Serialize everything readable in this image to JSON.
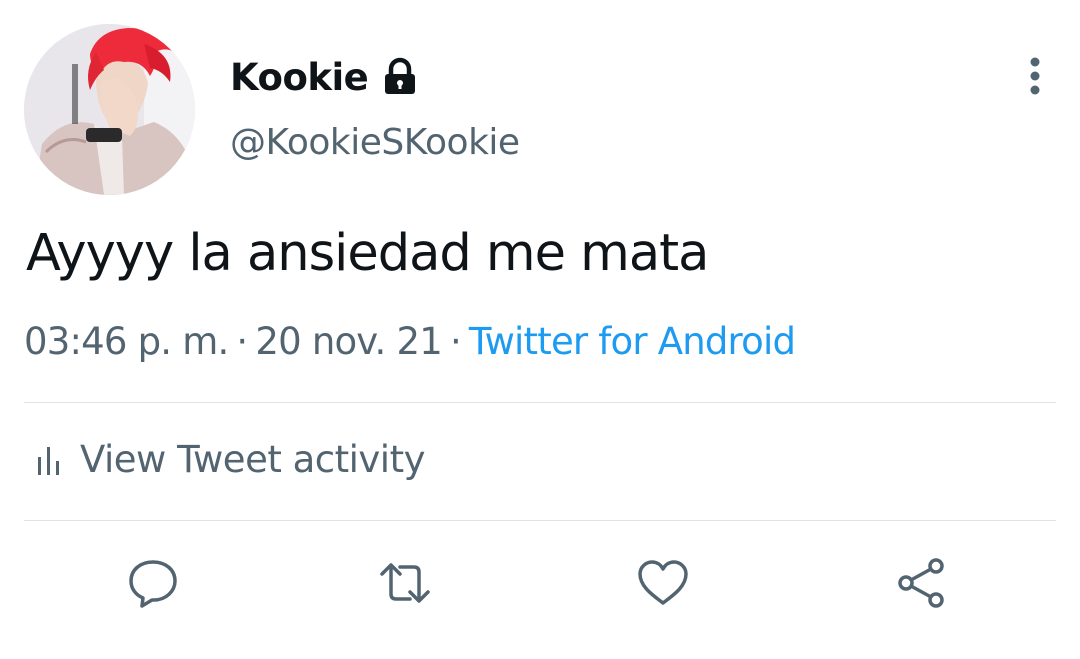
{
  "tweet": {
    "author": {
      "display_name": "Kookie",
      "handle": "@KookieSKookie",
      "protected": true,
      "avatar_icon": "profile-photo"
    },
    "text": "Ayyyy la ansiedad me mata",
    "time": "03:46 p. m.",
    "separator": "·",
    "date": "20 nov. 21",
    "source": "Twitter for Android",
    "activity_label": "View Tweet activity"
  },
  "icons": {
    "lock": "lock-icon",
    "more": "more-vertical-icon",
    "activity": "bar-chart-icon",
    "reply": "reply-icon",
    "retweet": "retweet-icon",
    "like": "heart-icon",
    "share": "share-icon"
  },
  "colors": {
    "text_primary": "#0f1419",
    "text_secondary": "#536471",
    "link": "#1d9bf0",
    "divider": "#dfe3e7",
    "icon": "#536471"
  }
}
